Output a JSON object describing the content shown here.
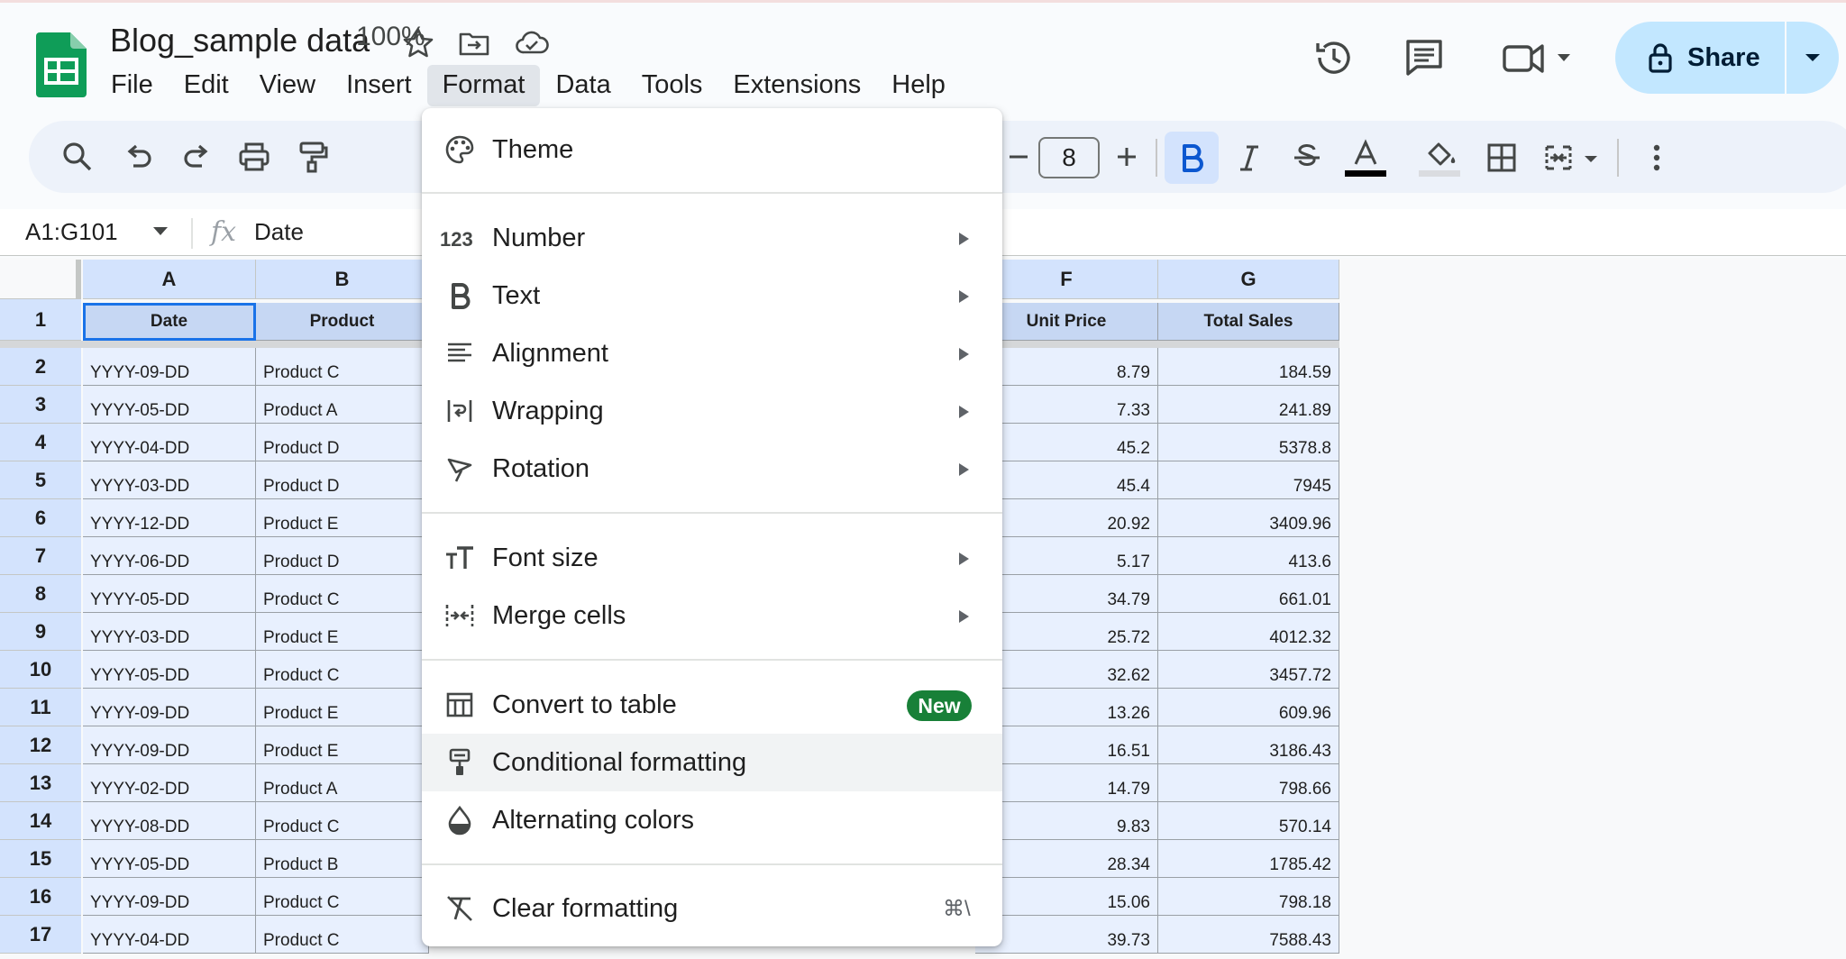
{
  "header": {
    "doc_title": "Blog_sample data",
    "menus": [
      "File",
      "Edit",
      "View",
      "Insert",
      "Format",
      "Data",
      "Tools",
      "Extensions",
      "Help"
    ],
    "active_menu": "Format",
    "share_label": "Share",
    "icons": [
      "sheets-logo-icon",
      "star-icon",
      "move-folder-icon",
      "cloud-saved-icon",
      "version-history-icon",
      "comments-icon",
      "meet-video-icon",
      "lock-icon"
    ]
  },
  "toolbar": {
    "zoom": "100%",
    "font_size": "8",
    "icons": [
      "search-icon",
      "undo-icon",
      "redo-icon",
      "print-icon",
      "paint-format-icon",
      "decrease-font-icon",
      "increase-font-icon",
      "bold-icon",
      "italic-icon",
      "strikethrough-icon",
      "text-color-icon",
      "fill-color-icon",
      "borders-icon",
      "merge-cells-icon",
      "more-icon"
    ]
  },
  "formula_bar": {
    "range": "A1:G101",
    "fx": "fx",
    "content": "Date"
  },
  "grid": {
    "columns": [
      {
        "id": "A",
        "label": "A"
      },
      {
        "id": "B",
        "label": "B"
      },
      {
        "id": "F",
        "label": "F"
      },
      {
        "id": "G",
        "label": "G"
      }
    ],
    "header_row": {
      "row": "1",
      "date": "Date",
      "product": "Product",
      "unit_price": "Unit Price",
      "total_sales": "Total Sales"
    },
    "rows": [
      {
        "row": "2",
        "date": "YYYY-09-DD",
        "product": "Product C",
        "unit_price": "8.79",
        "total_sales": "184.59"
      },
      {
        "row": "3",
        "date": "YYYY-05-DD",
        "product": "Product A",
        "unit_price": "7.33",
        "total_sales": "241.89"
      },
      {
        "row": "4",
        "date": "YYYY-04-DD",
        "product": "Product D",
        "unit_price": "45.2",
        "total_sales": "5378.8"
      },
      {
        "row": "5",
        "date": "YYYY-03-DD",
        "product": "Product D",
        "unit_price": "45.4",
        "total_sales": "7945"
      },
      {
        "row": "6",
        "date": "YYYY-12-DD",
        "product": "Product E",
        "unit_price": "20.92",
        "total_sales": "3409.96"
      },
      {
        "row": "7",
        "date": "YYYY-06-DD",
        "product": "Product D",
        "unit_price": "5.17",
        "total_sales": "413.6"
      },
      {
        "row": "8",
        "date": "YYYY-05-DD",
        "product": "Product C",
        "unit_price": "34.79",
        "total_sales": "661.01"
      },
      {
        "row": "9",
        "date": "YYYY-03-DD",
        "product": "Product E",
        "unit_price": "25.72",
        "total_sales": "4012.32"
      },
      {
        "row": "10",
        "date": "YYYY-05-DD",
        "product": "Product C",
        "unit_price": "32.62",
        "total_sales": "3457.72"
      },
      {
        "row": "11",
        "date": "YYYY-09-DD",
        "product": "Product E",
        "unit_price": "13.26",
        "total_sales": "609.96"
      },
      {
        "row": "12",
        "date": "YYYY-09-DD",
        "product": "Product E",
        "unit_price": "16.51",
        "total_sales": "3186.43"
      },
      {
        "row": "13",
        "date": "YYYY-02-DD",
        "product": "Product A",
        "unit_price": "14.79",
        "total_sales": "798.66"
      },
      {
        "row": "14",
        "date": "YYYY-08-DD",
        "product": "Product C",
        "unit_price": "9.83",
        "total_sales": "570.14"
      },
      {
        "row": "15",
        "date": "YYYY-05-DD",
        "product": "Product B",
        "unit_price": "28.34",
        "total_sales": "1785.42"
      },
      {
        "row": "16",
        "date": "YYYY-09-DD",
        "product": "Product C",
        "unit_price": "15.06",
        "total_sales": "798.18"
      },
      {
        "row": "17",
        "date": "YYYY-04-DD",
        "product": "Product C",
        "unit_price": "39.73",
        "total_sales": "7588.43"
      }
    ]
  },
  "format_menu": {
    "items": [
      {
        "id": "theme",
        "label": "Theme",
        "icon": "palette-icon"
      },
      {
        "id": "number",
        "label": "Number",
        "icon": "number-format-icon",
        "submenu": true
      },
      {
        "id": "text",
        "label": "Text",
        "icon": "bold-text-icon",
        "submenu": true
      },
      {
        "id": "alignment",
        "label": "Alignment",
        "icon": "align-left-icon",
        "submenu": true
      },
      {
        "id": "wrapping",
        "label": "Wrapping",
        "icon": "text-wrap-icon",
        "submenu": true
      },
      {
        "id": "rotation",
        "label": "Rotation",
        "icon": "text-rotation-icon",
        "submenu": true
      },
      {
        "id": "font-size",
        "label": "Font size",
        "icon": "font-size-icon",
        "submenu": true
      },
      {
        "id": "merge-cells",
        "label": "Merge cells",
        "icon": "merge-cells-icon",
        "submenu": true
      },
      {
        "id": "convert-to-table",
        "label": "Convert to table",
        "icon": "table-icon",
        "badge": "New"
      },
      {
        "id": "conditional-formatting",
        "label": "Conditional formatting",
        "icon": "paint-roller-icon",
        "highlighted": true
      },
      {
        "id": "alternating-colors",
        "label": "Alternating colors",
        "icon": "color-drop-icon"
      },
      {
        "id": "clear-formatting",
        "label": "Clear formatting",
        "icon": "clear-format-icon",
        "shortcut": "⌘\\"
      }
    ]
  },
  "colors": {
    "accent": "#1a73e8",
    "selection_fill": "#e8f0fe",
    "header_fill": "#d3e3fd",
    "share_button": "#c2e7ff",
    "new_badge": "#188038",
    "sheets_green": "#0f9d58"
  }
}
